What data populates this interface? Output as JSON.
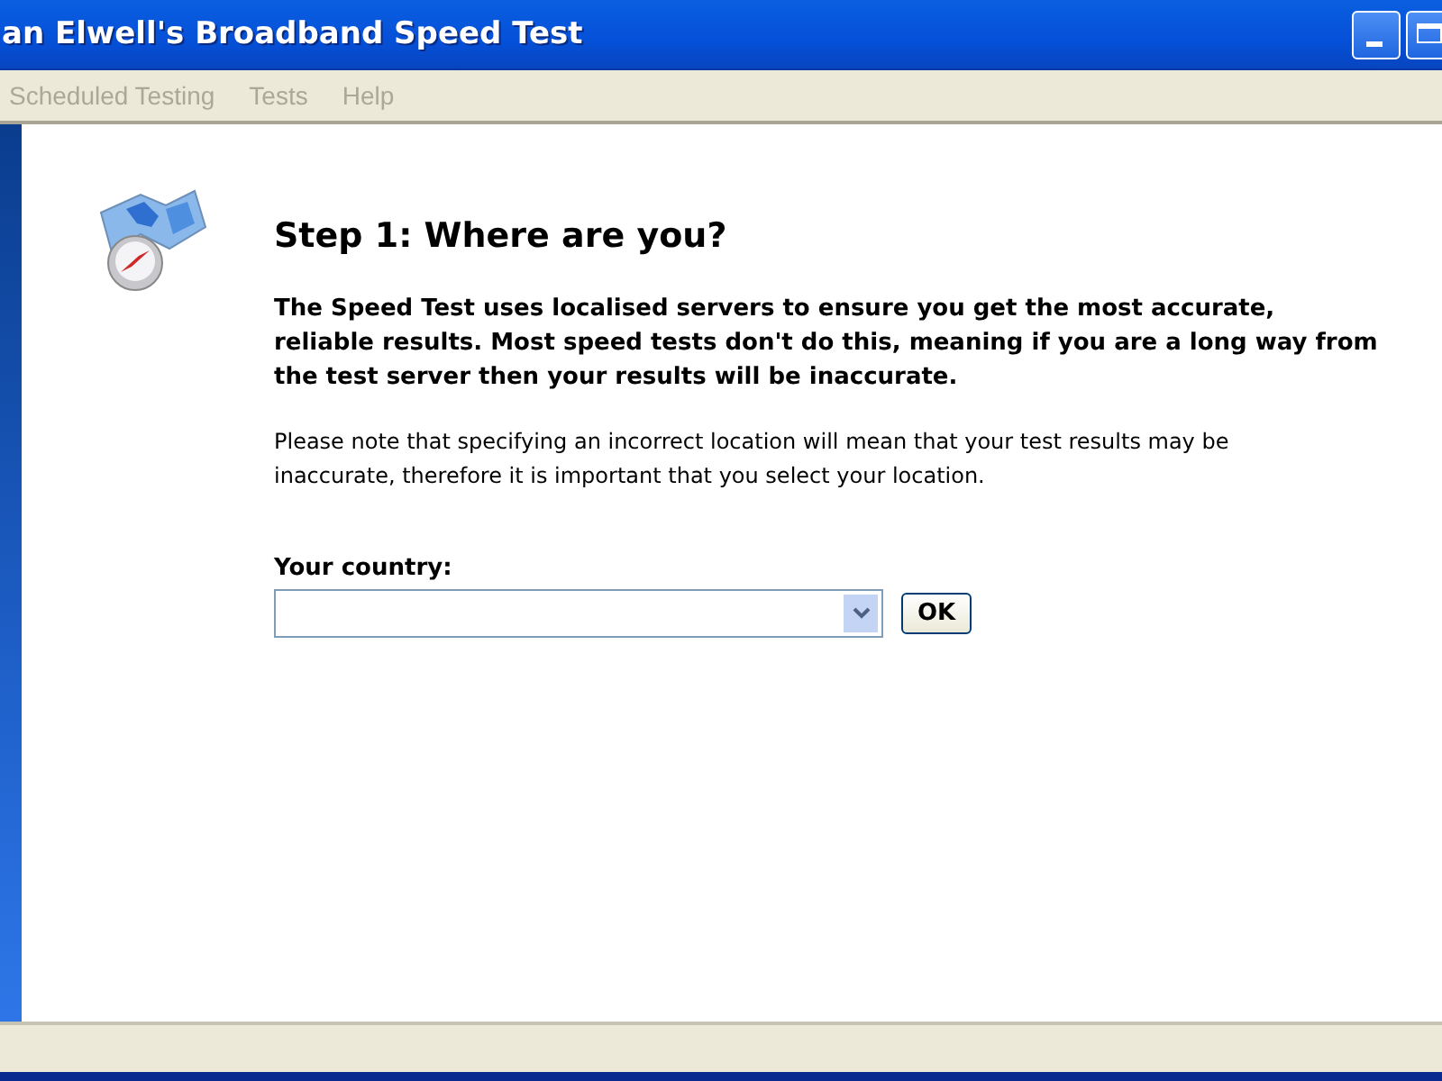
{
  "window": {
    "title": "an Elwell's Broadband Speed Test"
  },
  "menu": [
    {
      "label": "Scheduled Testing",
      "disabled": true
    },
    {
      "label": "Tests",
      "disabled": true
    },
    {
      "label": "Help",
      "disabled": true
    }
  ],
  "step": {
    "heading": "Step 1: Where are you?",
    "intro": "The Speed Test uses localised servers to ensure you get the most accurate, reliable results. Most speed tests don't do this, meaning if you are a long way from the test server then your results will be inaccurate.",
    "note": "Please note that specifying an incorrect location will mean that your test results may be inaccurate, therefore it is important that you select your location.",
    "country_label": "Your country:",
    "ok_button": "OK"
  }
}
